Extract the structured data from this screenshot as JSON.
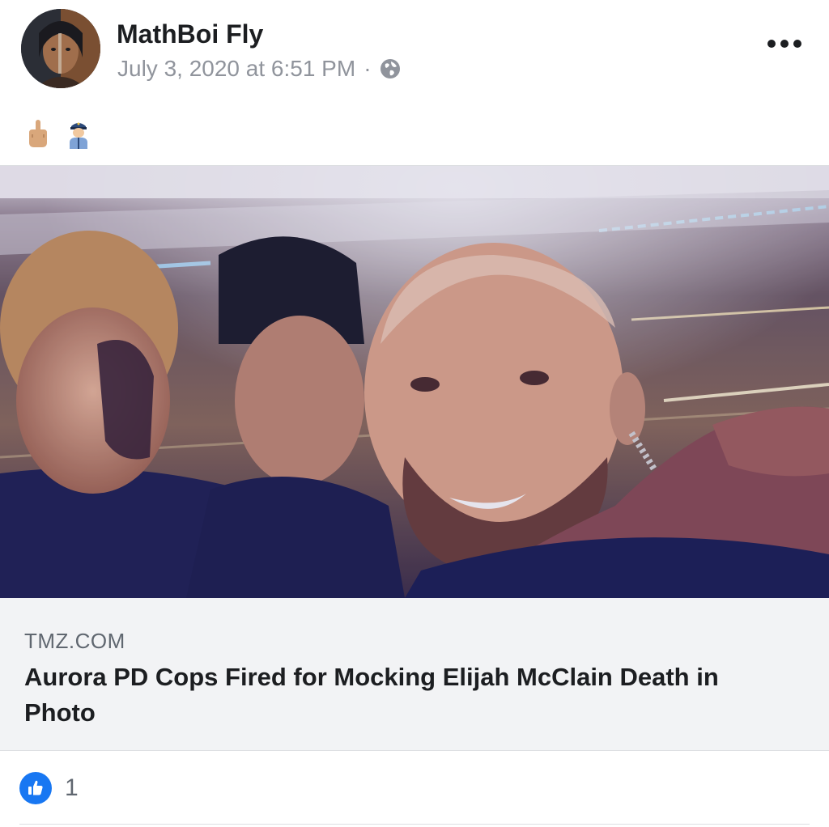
{
  "post": {
    "author": "MathBoi Fly",
    "timestamp": "July 3, 2020 at 6:51 PM",
    "separator": "·",
    "privacy_icon": "globe-icon",
    "menu_icon": "more-options-icon",
    "emojis": [
      "middle-finger-emoji",
      "police-officer-emoji"
    ]
  },
  "link_preview": {
    "domain": "TMZ.COM",
    "title": "Aurora PD Cops Fired for Mocking Elijah McClain Death in Photo",
    "image": "selfie-photo-of-officers"
  },
  "reactions": {
    "icon": "like-icon",
    "count": "1"
  },
  "colors": {
    "like_blue": "#1877f2",
    "meta_gray": "#90949c",
    "card_background": "#f2f3f5"
  }
}
